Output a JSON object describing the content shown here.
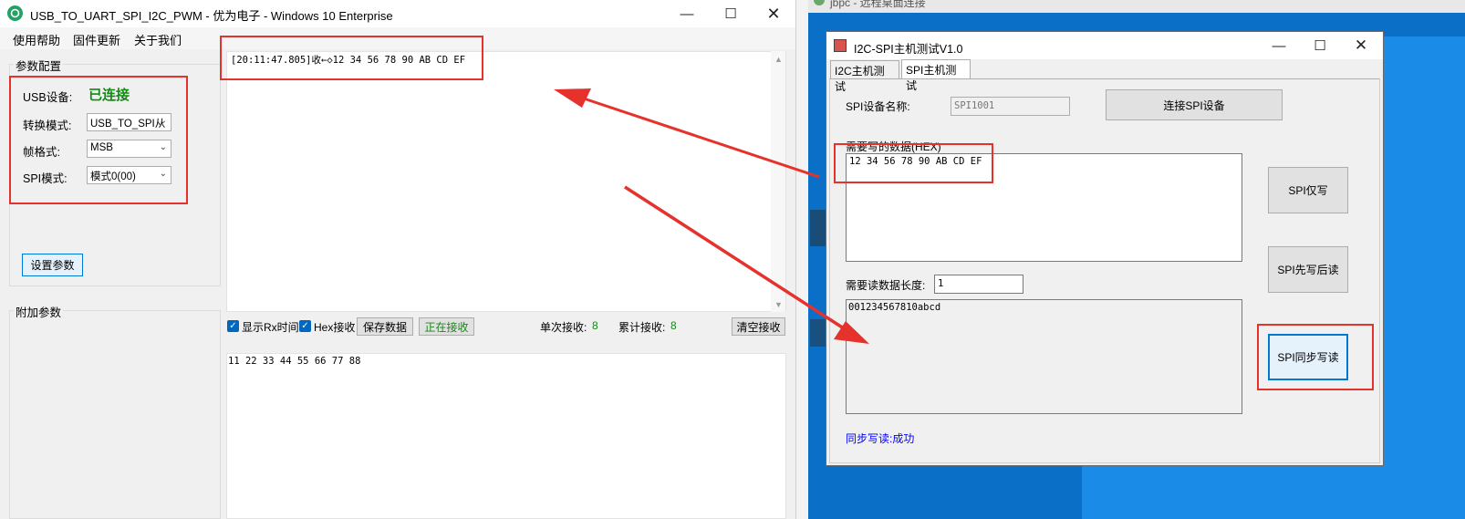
{
  "left_window": {
    "title": "USB_TO_UART_SPI_I2C_PWM - 优为电子 - Windows 10 Enterprise",
    "menu": [
      "使用帮助",
      "固件更新",
      "关于我们"
    ],
    "params_group_label": "参数配置",
    "usb_device_label": "USB设备:",
    "usb_status": "已连接",
    "convert_mode_label": "转换模式:",
    "convert_mode_value": "USB_TO_SPI从",
    "frame_format_label": "帧格式:",
    "frame_format_value": "MSB",
    "spi_mode_label": "SPI模式:",
    "spi_mode_value": "模式0(00)",
    "set_params_button": "设置参数",
    "extra_params_label": "附加参数",
    "receive_log": "[20:11:47.805]收←◇12 34 56 78 90 AB CD EF",
    "show_rx_time_label": "显示Rx时间",
    "hex_receive_label": "Hex接收",
    "save_data_button": "保存数据",
    "receiving_button": "正在接收",
    "single_receive_label": "单次接收:",
    "single_receive_value": "8",
    "total_receive_label": "累计接收:",
    "total_receive_value": "8",
    "clear_receive_button": "清空接收",
    "send_text": "11 22 33 44 55 66 77 88"
  },
  "rdp": {
    "title": "jbpc - 远程桌面连接"
  },
  "right_window": {
    "title": "I2C-SPI主机测试V1.0",
    "tabs": [
      "I2C主机测试",
      "SPI主机测试"
    ],
    "spi_device_label": "SPI设备名称:",
    "spi_device_value": "SPI1001",
    "connect_button": "连接SPI设备",
    "write_data_label": "需要写的数据(HEX)",
    "write_data_value": "12 34 56 78 90 AB CD EF",
    "read_length_label": "需要读数据长度:",
    "read_length_value": "1",
    "read_data_value": "001234567810abcd",
    "spi_write_only_button": "SPI仅写",
    "spi_write_then_read_button": "SPI先写后读",
    "spi_sync_rw_button": "SPI同步写读",
    "status_text": "同步写读:成功"
  },
  "colors": {
    "annotation_red": "#e5322d",
    "connected_green": "#138a13",
    "status_blue": "#0000ff",
    "desktop_blue": "#0a6fc7"
  }
}
